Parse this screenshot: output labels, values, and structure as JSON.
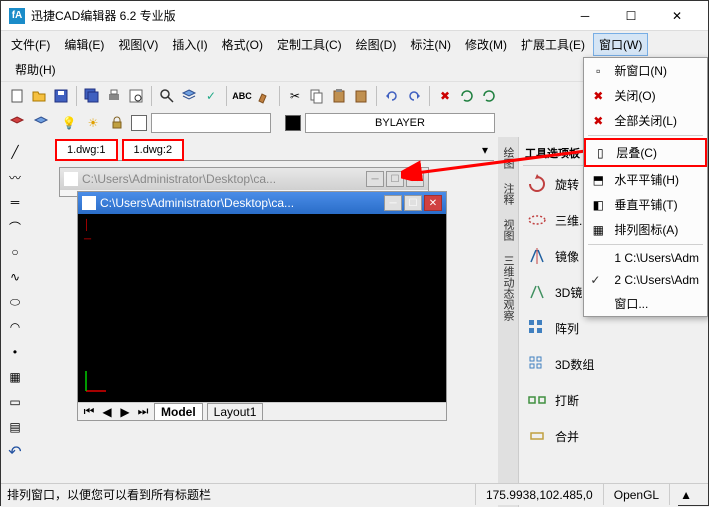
{
  "app": {
    "icon_letter": "fA",
    "title": "迅捷CAD编辑器 6.2 专业版"
  },
  "menu": {
    "file": "文件(F)",
    "edit": "编辑(E)",
    "view": "视图(V)",
    "insert": "插入(I)",
    "format": "格式(O)",
    "custom_tools": "定制工具(C)",
    "draw": "绘图(D)",
    "annotate": "标注(N)",
    "modify": "修改(M)",
    "extend_tools": "扩展工具(E)",
    "window": "窗口(W)",
    "help": "帮助(H)"
  },
  "proprow": {
    "bylayer": "BYLAYER"
  },
  "tabs": {
    "tab1": "1.dwg:1",
    "tab2": "1.dwg:2"
  },
  "mdi": {
    "path": "C:\\Users\\Administrator\\Desktop\\ca...",
    "model": "Model",
    "layout1": "Layout1"
  },
  "right": {
    "palette_title": "工具选项板",
    "rotate": "旋转",
    "three_d": "三维...",
    "mirror": "镜像",
    "mirror3d": "3D镜...",
    "array": "阵列",
    "array3d": "3D数组",
    "break": "打断",
    "merge": "合并"
  },
  "fold_labels": {
    "draw": "绘图",
    "annotate": "注释",
    "view": "视图",
    "dynamic_observe": "三维动态观察"
  },
  "window_menu": {
    "new_window": "新窗口(N)",
    "close": "关闭(O)",
    "close_all": "全部关闭(L)",
    "cascade": "层叠(C)",
    "tile_horiz": "水平平铺(H)",
    "tile_vert": "垂直平铺(T)",
    "arrange": "排列图标(A)",
    "win1": "1 C:\\Users\\Adm",
    "win2": "2 C:\\Users\\Adm",
    "windows": "窗口..."
  },
  "status": {
    "hint": "排列窗口，以便您可以看到所有标题栏",
    "coords": "175.9938,102.485,0",
    "renderer": "OpenGL"
  }
}
